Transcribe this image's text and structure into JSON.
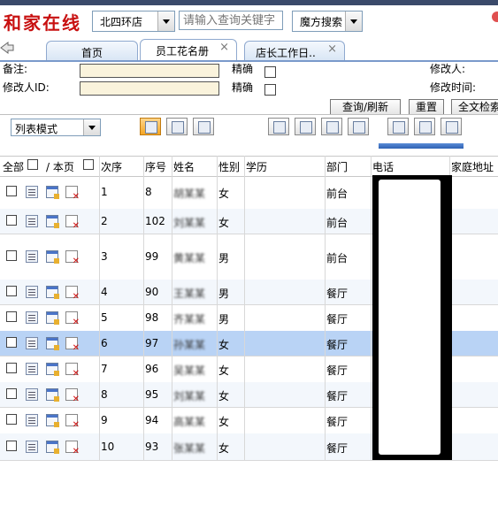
{
  "header": {
    "brand": "和家在线",
    "store_select": "北四环店",
    "search_placeholder": "请输入查询关键字",
    "magic_search": "魔方搜索"
  },
  "tabs": [
    {
      "label": "首页"
    },
    {
      "label": "员工花名册",
      "active": true
    },
    {
      "label": "店长工作日.."
    }
  ],
  "form": {
    "remark_label": "备注:",
    "modifier_id_label": "修改人ID:",
    "exact_label": "精确",
    "modifier_label": "修改人:",
    "modify_time_label": "修改时间:",
    "query_refresh": "查询/刷新",
    "reset": "重置",
    "fulltext": "全文检索"
  },
  "toolbar": {
    "mode_select": "列表模式"
  },
  "table": {
    "headers": {
      "select_all": "全部",
      "page": "/ 本页",
      "order": "次序",
      "seq": "序号",
      "name": "姓名",
      "gender": "性别",
      "education": "学历",
      "department": "部门",
      "phone": "电话",
      "address": "家庭地址"
    },
    "rows": [
      {
        "order": "1",
        "seq": "8",
        "name": "胡某某",
        "gender": "女",
        "department": "前台"
      },
      {
        "order": "2",
        "seq": "102",
        "name": "刘某某",
        "gender": "女",
        "department": "前台"
      },
      {
        "order": "3",
        "seq": "99",
        "name": "黄某某",
        "gender": "男",
        "department": "前台"
      },
      {
        "order": "4",
        "seq": "90",
        "name": "王某某",
        "gender": "男",
        "department": "餐厅"
      },
      {
        "order": "5",
        "seq": "98",
        "name": "齐某某",
        "gender": "男",
        "department": "餐厅"
      },
      {
        "order": "6",
        "seq": "97",
        "name": "孙某某",
        "gender": "女",
        "department": "餐厅"
      },
      {
        "order": "7",
        "seq": "96",
        "name": "吴某某",
        "gender": "女",
        "department": "餐厅"
      },
      {
        "order": "8",
        "seq": "95",
        "name": "刘某某",
        "gender": "女",
        "department": "餐厅"
      },
      {
        "order": "9",
        "seq": "94",
        "name": "高某某",
        "gender": "女",
        "department": "餐厅"
      },
      {
        "order": "10",
        "seq": "93",
        "name": "张某某",
        "gender": "女",
        "department": "餐厅"
      }
    ]
  },
  "colors": {
    "brand": "#c81010",
    "selected_row": "#b9d3f5",
    "tab_border": "#8fa9cf"
  }
}
